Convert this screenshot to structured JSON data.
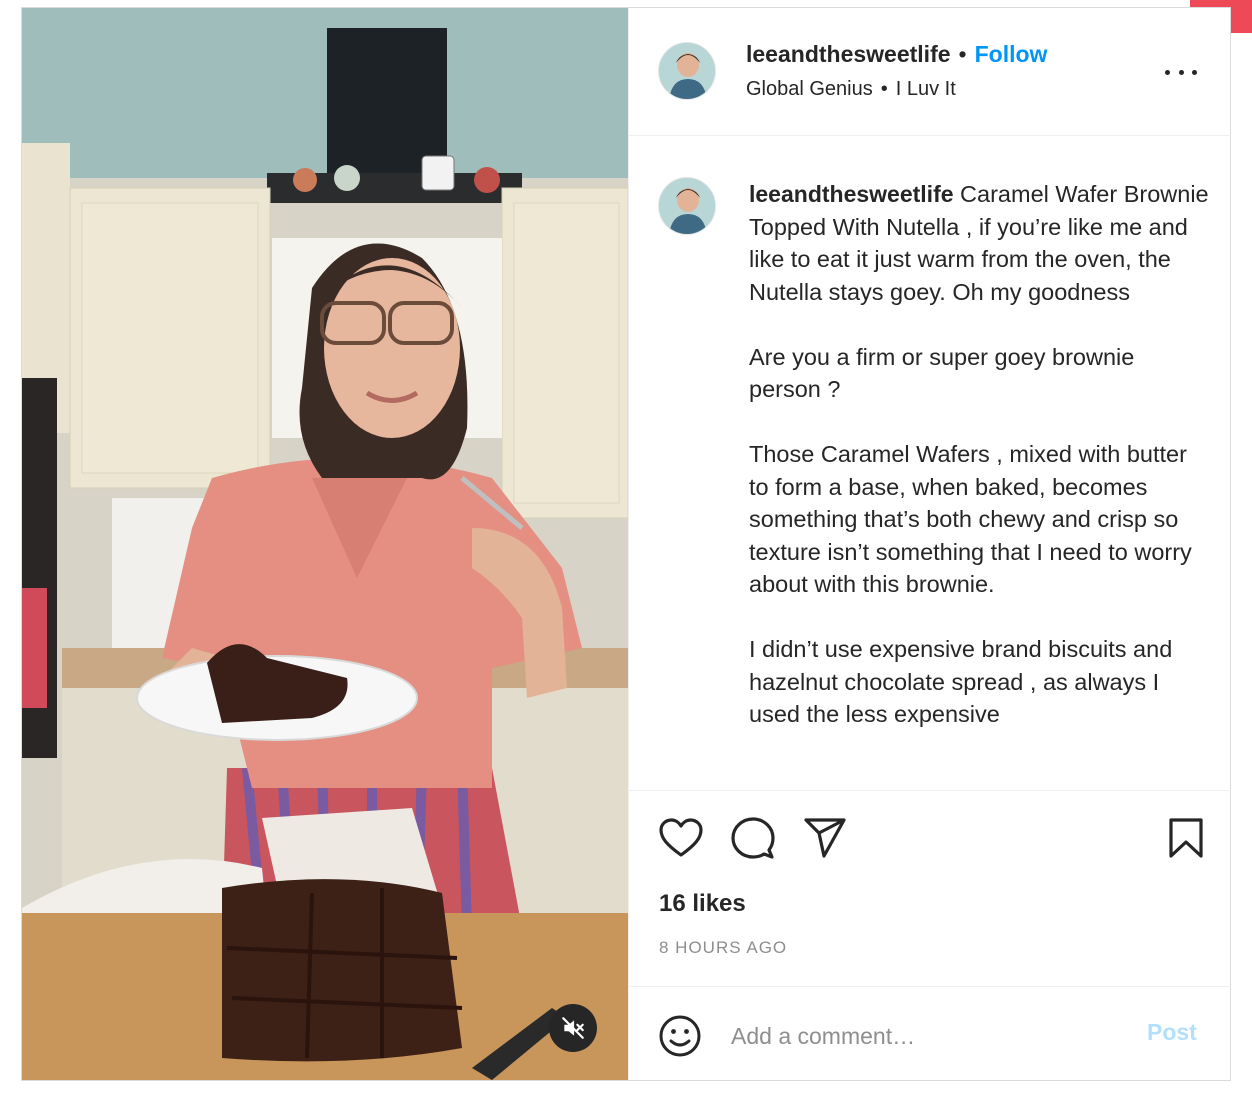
{
  "header": {
    "username": "leeandthesweetlife",
    "separator": "•",
    "follow_label": "Follow",
    "subtitle_left": "Global Genius",
    "subtitle_right": "I Luv It"
  },
  "caption": {
    "username": "leeandthesweetlife",
    "first_text": " Caramel Wafer Brownie Topped With Nutella , if you’re like me and like to eat it just warm from the oven, the Nutella stays goey. Oh my goodness",
    "paragraphs": [
      "Are you a firm or super goey brownie person ?",
      "Those Caramel Wafers , mixed with butter to form a base, when baked, becomes something that’s both chewy and crisp so texture isn’t something that I need to worry about with this brownie.",
      "I didn’t use expensive brand biscuits and hazelnut chocolate spread , as always I used the less expensive"
    ]
  },
  "stats": {
    "likes": "16 likes",
    "time": "8 HOURS AGO"
  },
  "comment": {
    "placeholder": "Add a comment…",
    "post_label": "Post"
  },
  "colors": {
    "accent": "#0095f6",
    "post_disabled": "#b2dffc",
    "text": "#262626",
    "muted": "#8e8e8e",
    "notification": "#ed4956"
  },
  "icons": {
    "more": "more-options-icon",
    "like": "heart-icon",
    "comment": "comment-icon",
    "share": "share-icon",
    "save": "bookmark-icon",
    "emoji": "emoji-icon",
    "mute": "muted-speaker-icon"
  }
}
